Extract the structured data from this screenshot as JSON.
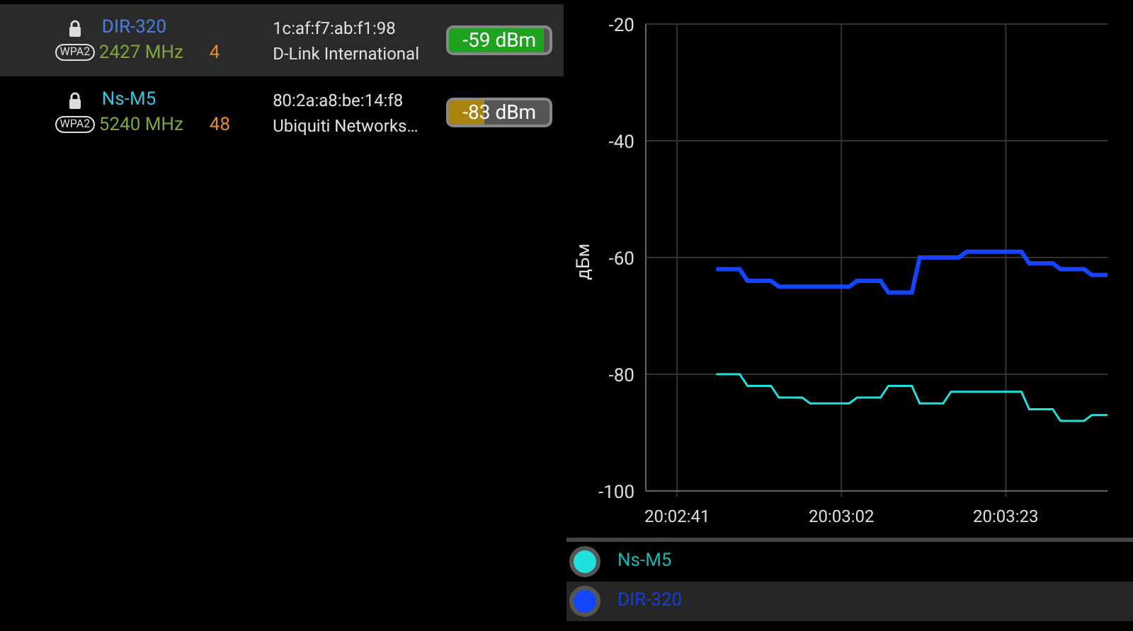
{
  "networks": [
    {
      "ssid": "DIR-320",
      "color": "#4a7fe0",
      "security": "WPA2",
      "frequency": "2427 MHz",
      "channel": "4",
      "mac": "1c:af:f7:ab:f1:98",
      "vendor": "D-Link International",
      "signal": "-59 dBm",
      "level": 0.95,
      "selected": true
    },
    {
      "ssid": "Ns-M5",
      "color": "#35c4d8",
      "security": "WPA2",
      "frequency": "5240 MHz",
      "channel": "48",
      "mac": "80:2a:a8:be:14:f8",
      "vendor": "Ubiquiti Networks…",
      "signal": "-83 dBm",
      "level": 0.35,
      "selected": false
    }
  ],
  "chart": {
    "chart_data": {
      "type": "line",
      "grid": true,
      "ylabel": "дБм",
      "categories": [
        null,
        null,
        null,
        null,
        "20:02:41",
        null,
        null,
        null,
        null,
        null,
        null,
        null,
        null,
        null,
        null,
        null,
        null,
        null,
        null,
        null,
        null,
        null,
        null,
        null,
        null,
        "20:03:02",
        null,
        null,
        null,
        null,
        null,
        null,
        null,
        null,
        null,
        null,
        null,
        null,
        null,
        null,
        null,
        null,
        null,
        null,
        null,
        null,
        "20:03:23",
        null,
        null,
        null,
        null,
        null,
        null,
        null,
        null,
        null,
        null,
        null,
        null,
        null
      ],
      "ylim": [
        -100,
        -20
      ],
      "yticks": [
        -20,
        -40,
        -60,
        -80,
        -100
      ],
      "series": [
        {
          "name": "Ns-M5",
          "color": "#22e0dc",
          "values": [
            null,
            null,
            null,
            null,
            null,
            null,
            null,
            null,
            null,
            -80,
            -80,
            -80,
            -80,
            -82,
            -82,
            -82,
            -82,
            -84,
            -84,
            -84,
            -84,
            -85,
            -85,
            -85,
            -85,
            -85,
            -85,
            -84,
            -84,
            -84,
            -84,
            -82,
            -82,
            -82,
            -82,
            -85,
            -85,
            -85,
            -85,
            -83,
            -83,
            -83,
            -83,
            -83,
            -83,
            -83,
            -83,
            -83,
            -83,
            -86,
            -86,
            -86,
            -86,
            -88,
            -88,
            -88,
            -88,
            -87,
            -87,
            -87
          ]
        },
        {
          "name": "DIR-320",
          "color": "#1446ff",
          "values": [
            null,
            null,
            null,
            null,
            null,
            null,
            null,
            null,
            null,
            -62,
            -62,
            -62,
            -62,
            -64,
            -64,
            -64,
            -64,
            -65,
            -65,
            -65,
            -65,
            -65,
            -65,
            -65,
            -65,
            -65,
            -65,
            -64,
            -64,
            -64,
            -64,
            -66,
            -66,
            -66,
            -66,
            -60,
            -60,
            -60,
            -60,
            -60,
            -60,
            -59,
            -59,
            -59,
            -59,
            -59,
            -59,
            -59,
            -59,
            -61,
            -61,
            -61,
            -61,
            -62,
            -62,
            -62,
            -62,
            -63,
            -63,
            -63
          ]
        }
      ]
    }
  },
  "legend": [
    {
      "selected": false
    },
    {
      "selected": true
    }
  ]
}
